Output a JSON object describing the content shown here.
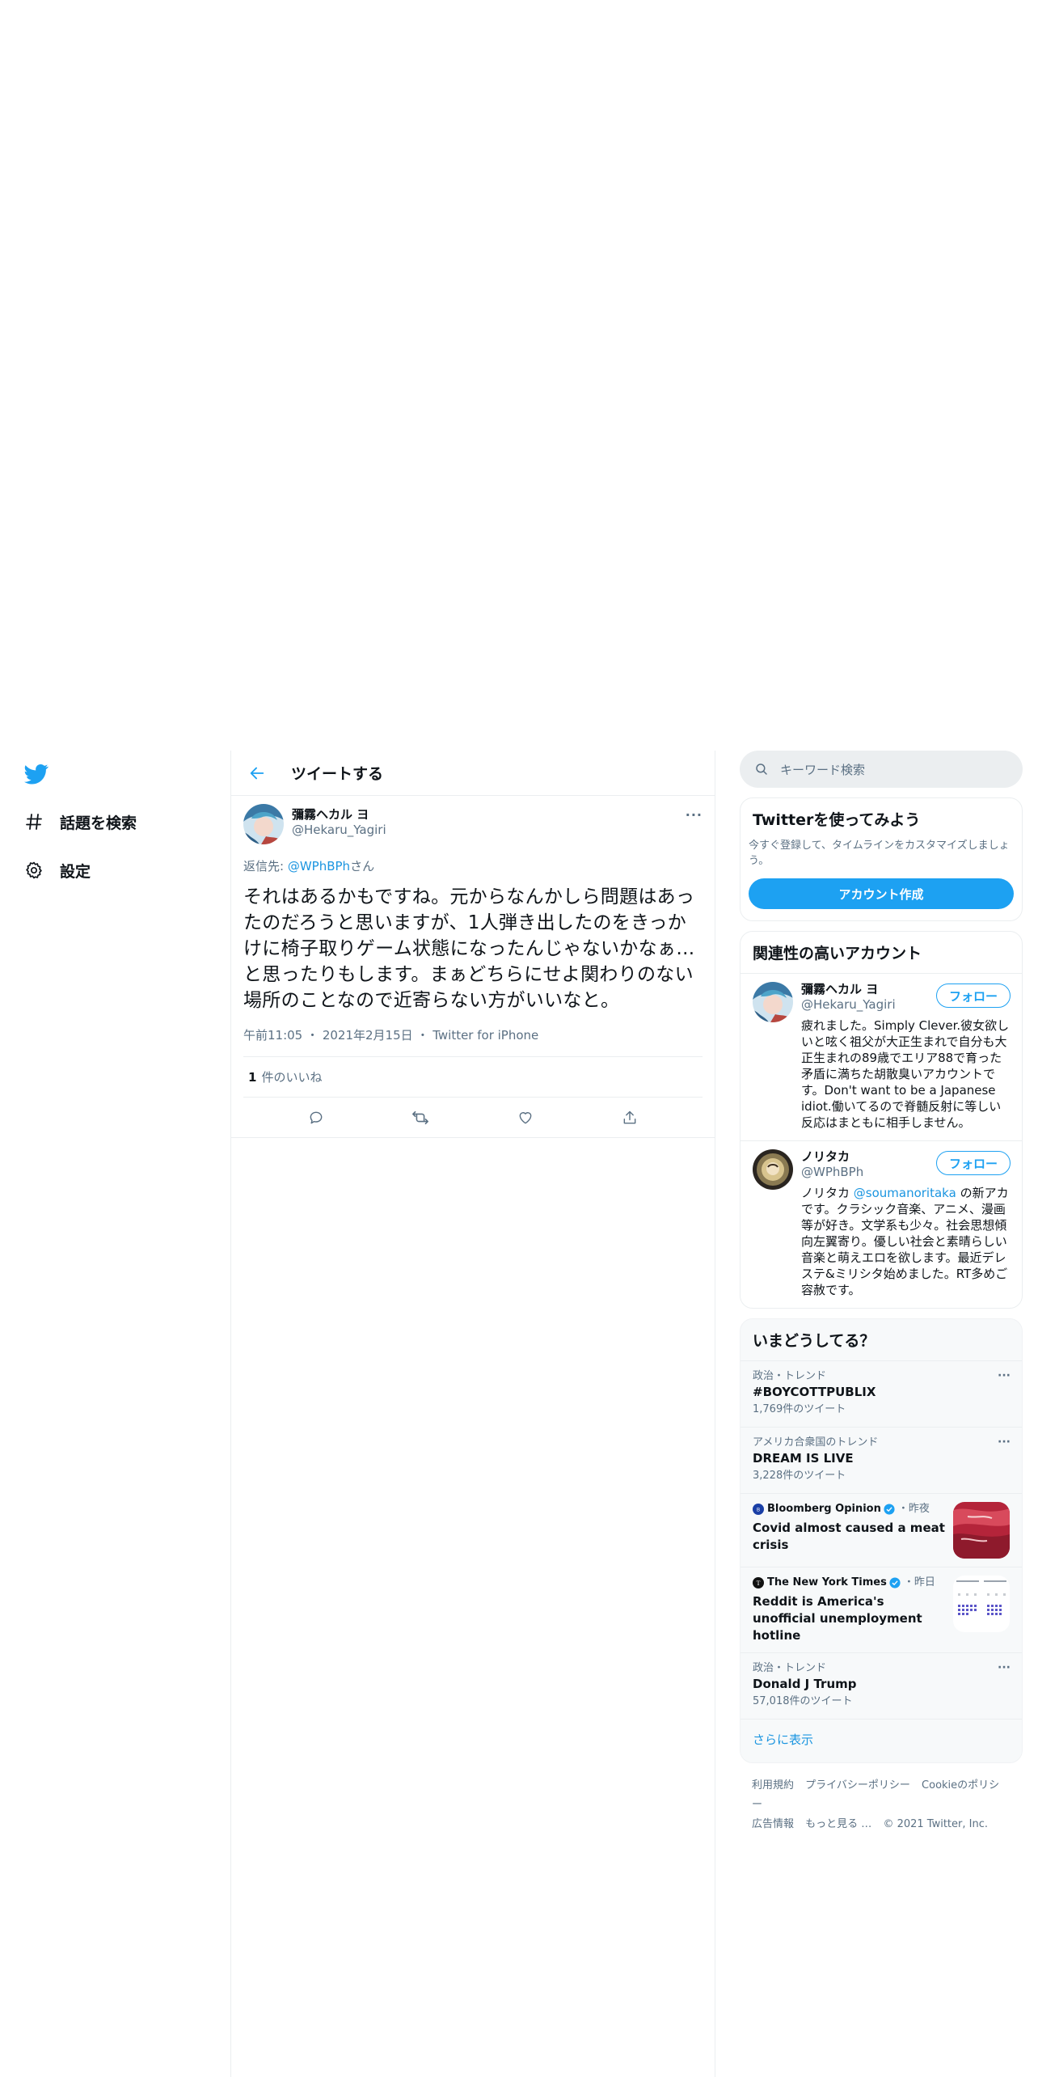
{
  "nav": {
    "items": [
      {
        "label": "話題を検索",
        "icon": "hashtag-icon"
      },
      {
        "label": "設定",
        "icon": "gear-icon"
      }
    ]
  },
  "header": {
    "title": "ツイートする"
  },
  "tweet": {
    "display_name": "彌霧ヘカル ヨ",
    "handle": "@Hekaru_Yagiri",
    "reply_prefix": "返信先: ",
    "reply_mention": "@WPhBPh",
    "reply_suffix": "さん",
    "text": "それはあるかもですね。元からなんかしら問題はあったのだろうと思いますが、1人弾き出したのをきっかけに椅子取りゲーム状態になったんじゃないかなぁ…と思ったりもします。まぁどちらにせよ関わりのない場所のことなので近寄らない方がいいなと。",
    "time": "午前11:05",
    "date": "2021年2月15日",
    "client": "Twitter for iPhone",
    "likes_count": "1",
    "likes_label": "件のいいね",
    "more": "···"
  },
  "search": {
    "placeholder": "キーワード検索"
  },
  "signup": {
    "title": "Twitterを使ってみよう",
    "desc": "今すぐ登録して、タイムラインをカスタマイズしましょう。",
    "button": "アカウント作成"
  },
  "related": {
    "title": "関連性の高いアカウント",
    "follow_label": "フォロー",
    "accounts": [
      {
        "name": "彌霧ヘカル ヨ",
        "handle": "@Hekaru_Yagiri",
        "bio": "疲れました。Simply Clever.彼女欲しいと呟く祖父が大正生まれで自分も大正生まれの89歳でエリア88で育った矛盾に満ちた胡散臭いアカウントです。Don't want to be a Japanese idiot.働いてるので脊髄反射に等しい反応はまともに相手しません。"
      },
      {
        "name": "ノリタカ",
        "handle": "@WPhBPh",
        "bio_prefix": "ノリタカ ",
        "bio_mention": "@soumanoritaka",
        "bio_suffix": " の新アカです。クラシック音楽、アニメ、漫画等が好き。文学系も少々。社会思想傾向左翼寄り。優しい社会と素晴らしい音楽と萌えエロを欲します。最近デレステ&ミリシタ始めました。RT多めご容赦です。"
      }
    ]
  },
  "trends": {
    "title": "いまどうしてる？",
    "items": [
      {
        "context": "政治・トレンド",
        "title": "#BOYCOTTPUBLIX",
        "count": "1,769件のツイート"
      },
      {
        "context": "アメリカ合衆国のトレンド",
        "title": "DREAM IS LIVE",
        "count": "3,228件のツイート"
      },
      {
        "context": "政治・トレンド",
        "title": "Donald J Trump",
        "count": "57,018件のツイート"
      }
    ],
    "news": [
      {
        "source": "Bloomberg Opinion",
        "ago": "・昨夜",
        "title": "Covid almost caused a meat crisis"
      },
      {
        "source": "The New York Times",
        "ago": "・昨日",
        "title": "Reddit is America's unofficial unemployment hotline"
      }
    ],
    "show_more": "さらに表示",
    "more": "···"
  },
  "footer": {
    "links": [
      "利用規約",
      "プライバシーポリシー",
      "Cookieのポリシー",
      "広告情報",
      "もっと見る …"
    ],
    "copyright": "© 2021 Twitter, Inc."
  },
  "colors": {
    "accent": "#1da1f2",
    "link": "#1b95e0",
    "muted": "#5b7083",
    "border": "#ebeef0"
  }
}
